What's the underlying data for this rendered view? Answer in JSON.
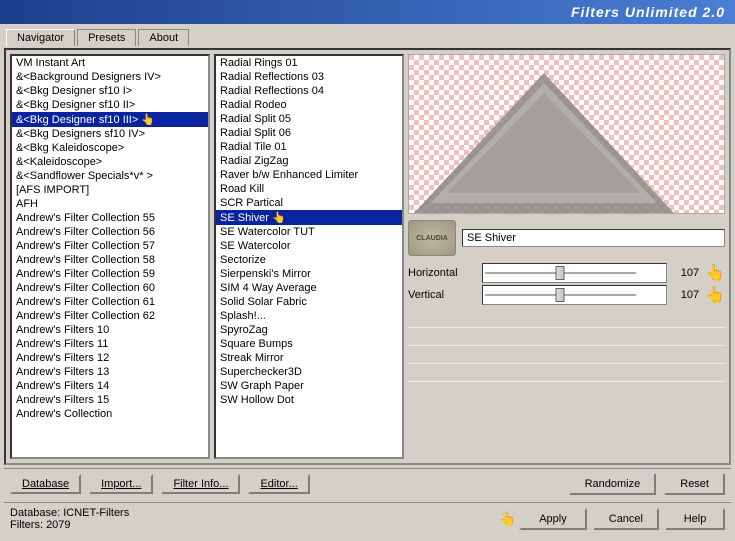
{
  "titleBar": {
    "text": "Filters Unlimited 2.0"
  },
  "tabs": [
    {
      "id": "navigator",
      "label": "Navigator",
      "active": true
    },
    {
      "id": "presets",
      "label": "Presets",
      "active": false
    },
    {
      "id": "about",
      "label": "About",
      "active": false
    }
  ],
  "leftList": {
    "items": [
      {
        "id": 0,
        "label": "VM Instant Art",
        "selected": false
      },
      {
        "id": 1,
        "label": "&<Background Designers IV>",
        "selected": false
      },
      {
        "id": 2,
        "label": "&<Bkg Designer sf10 I>",
        "selected": false
      },
      {
        "id": 3,
        "label": "&<Bkg Designer sf10 II>",
        "selected": false
      },
      {
        "id": 4,
        "label": "&<Bkg Designer sf10 III>",
        "selected": true
      },
      {
        "id": 5,
        "label": "&<Bkg Designers sf10 IV>",
        "selected": false
      },
      {
        "id": 6,
        "label": "&<Bkg Kaleidoscope>",
        "selected": false
      },
      {
        "id": 7,
        "label": "&<Kaleidoscope>",
        "selected": false
      },
      {
        "id": 8,
        "label": "&<Sandflower Specials*v* >",
        "selected": false
      },
      {
        "id": 9,
        "label": "[AFS IMPORT]",
        "selected": false
      },
      {
        "id": 10,
        "label": "AFH",
        "selected": false
      },
      {
        "id": 11,
        "label": "Andrew's Filter Collection 55",
        "selected": false
      },
      {
        "id": 12,
        "label": "Andrew's Filter Collection 56",
        "selected": false
      },
      {
        "id": 13,
        "label": "Andrew's Filter Collection 57",
        "selected": false
      },
      {
        "id": 14,
        "label": "Andrew's Filter Collection 58",
        "selected": false
      },
      {
        "id": 15,
        "label": "Andrew's Filter Collection 59",
        "selected": false
      },
      {
        "id": 16,
        "label": "Andrew's Filter Collection 60",
        "selected": false
      },
      {
        "id": 17,
        "label": "Andrew's Filter Collection 61",
        "selected": false
      },
      {
        "id": 18,
        "label": "Andrew's Filter Collection 62",
        "selected": false
      },
      {
        "id": 19,
        "label": "Andrew's Filters 10",
        "selected": false
      },
      {
        "id": 20,
        "label": "Andrew's Filters 11",
        "selected": false
      },
      {
        "id": 21,
        "label": "Andrew's Filters 12",
        "selected": false
      },
      {
        "id": 22,
        "label": "Andrew's Filters 13",
        "selected": false
      },
      {
        "id": 23,
        "label": "Andrew's Filters 14",
        "selected": false
      },
      {
        "id": 24,
        "label": "Andrew's Filters 15",
        "selected": false
      },
      {
        "id": 25,
        "label": "Andrew's Collection",
        "selected": false
      }
    ]
  },
  "middleList": {
    "items": [
      {
        "id": 0,
        "label": "Radial  Rings 01",
        "selected": false
      },
      {
        "id": 1,
        "label": "Radial Reflections 03",
        "selected": false
      },
      {
        "id": 2,
        "label": "Radial Reflections 04",
        "selected": false
      },
      {
        "id": 3,
        "label": "Radial Rodeo",
        "selected": false
      },
      {
        "id": 4,
        "label": "Radial Split 05",
        "selected": false
      },
      {
        "id": 5,
        "label": "Radial Split 06",
        "selected": false
      },
      {
        "id": 6,
        "label": "Radial Tile 01",
        "selected": false
      },
      {
        "id": 7,
        "label": "Radial ZigZag",
        "selected": false
      },
      {
        "id": 8,
        "label": "Raver b/w Enhanced Limiter",
        "selected": false
      },
      {
        "id": 9,
        "label": "Road Kill",
        "selected": false
      },
      {
        "id": 10,
        "label": "SCR  Partical",
        "selected": false
      },
      {
        "id": 11,
        "label": "SE Shiver",
        "selected": true
      },
      {
        "id": 12,
        "label": "SE Watercolor TUT",
        "selected": false
      },
      {
        "id": 13,
        "label": "SE Watercolor",
        "selected": false
      },
      {
        "id": 14,
        "label": "Sectorize",
        "selected": false
      },
      {
        "id": 15,
        "label": "Sierpenski's Mirror",
        "selected": false
      },
      {
        "id": 16,
        "label": "SIM 4 Way Average",
        "selected": false
      },
      {
        "id": 17,
        "label": "Solid Solar Fabric",
        "selected": false
      },
      {
        "id": 18,
        "label": "Splash!...",
        "selected": false
      },
      {
        "id": 19,
        "label": "SpyroZag",
        "selected": false
      },
      {
        "id": 20,
        "label": "Square Bumps",
        "selected": false
      },
      {
        "id": 21,
        "label": "Streak Mirror",
        "selected": false
      },
      {
        "id": 22,
        "label": "Superchecker3D",
        "selected": false
      },
      {
        "id": 23,
        "label": "SW Graph Paper",
        "selected": false
      },
      {
        "id": 24,
        "label": "SW Hollow Dot",
        "selected": false
      }
    ]
  },
  "preview": {
    "filterName": "SE Shiver",
    "logoText": "CLAUDIA"
  },
  "params": [
    {
      "id": 0,
      "label": "Horizontal",
      "value": 107,
      "min": 0,
      "max": 255,
      "thumbPos": 42
    },
    {
      "id": 1,
      "label": "Vertical",
      "value": 107,
      "min": 0,
      "max": 255,
      "thumbPos": 42
    }
  ],
  "emptyParams": [
    3,
    4,
    5,
    6
  ],
  "bottomButtons": {
    "database": "Database",
    "import": "Import...",
    "filterInfo": "Filter Info...",
    "editor": "Editor..."
  },
  "actionButtons": {
    "dbLabel": "Database:",
    "dbValue": "ICNET-Filters",
    "filtersLabel": "Filters:",
    "filtersValue": "2079",
    "randomize": "Randomize",
    "reset": "Reset",
    "apply": "Apply",
    "cancel": "Cancel",
    "help": "Help"
  }
}
